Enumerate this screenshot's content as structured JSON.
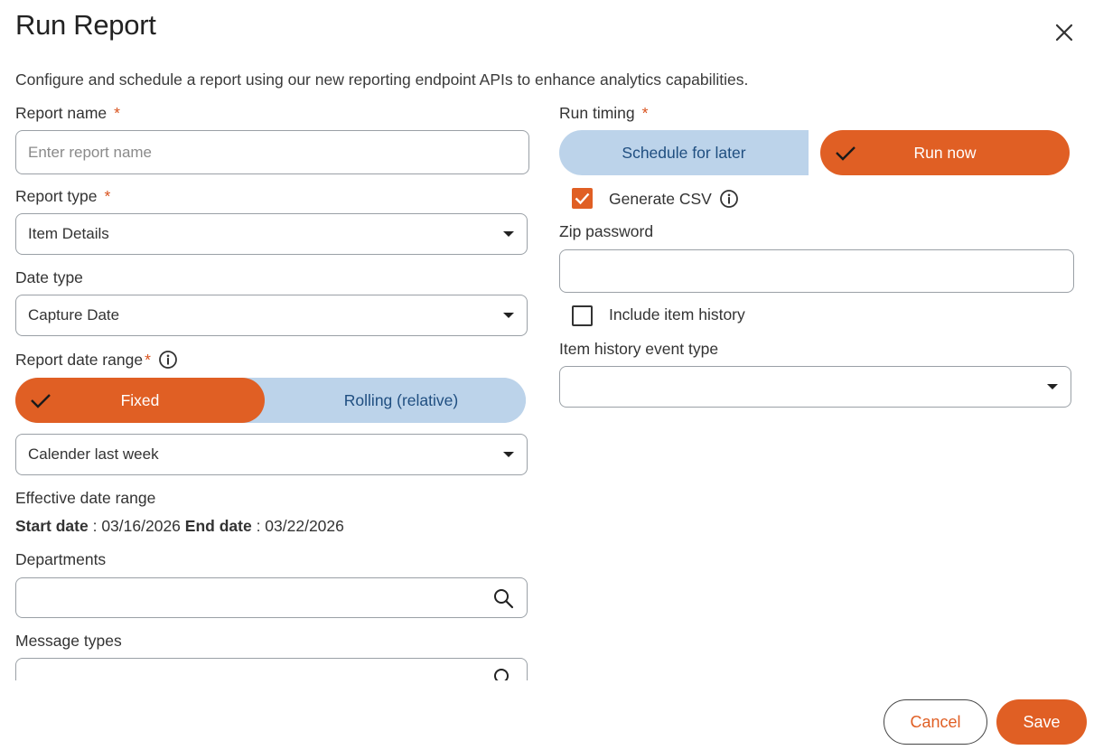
{
  "dialog": {
    "title": "Run Report",
    "subtitle": "Configure and schedule a report using our new reporting endpoint APIs to enhance analytics capabilities."
  },
  "fields": {
    "report_name": {
      "label": "Report name",
      "required": "*",
      "placeholder": "Enter report name",
      "value": ""
    },
    "report_type": {
      "label": "Report type",
      "required": "*",
      "value": "Item Details"
    },
    "date_type": {
      "label": "Date type",
      "value": "Capture Date"
    },
    "report_date_range": {
      "label": "Report date range",
      "required": "*",
      "options": [
        "Fixed",
        "Rolling (relative)"
      ],
      "selected": "Fixed",
      "range_value": "Calender last week"
    },
    "effective_date_range": {
      "label": "Effective date range",
      "start_label": "Start date",
      "start_value": ": 03/16/2026",
      "end_label": "End date",
      "end_value": ": 03/22/2026"
    },
    "departments": {
      "label": "Departments",
      "value": ""
    },
    "message_types": {
      "label": "Message types",
      "value": ""
    },
    "run_timing": {
      "label": "Run timing",
      "required": "*",
      "options": [
        "Schedule for later",
        "Run now"
      ],
      "selected": "Run now"
    },
    "generate_csv": {
      "label": "Generate CSV",
      "checked": true
    },
    "zip_password": {
      "label": "Zip password",
      "value": ""
    },
    "include_item_history": {
      "label": "Include item history",
      "checked": false
    },
    "item_history_event_type": {
      "label": "Item history event type",
      "value": ""
    }
  },
  "footer": {
    "cancel_label": "Cancel",
    "save_label": "Save"
  },
  "icons": [
    "close-icon",
    "info-icon",
    "check-icon",
    "search-icon",
    "chevron-down-icon"
  ],
  "colors": {
    "accent": "#e05f24",
    "inactive_segment": "#bcd3ea",
    "inactive_segment_text": "#1f4e80"
  }
}
